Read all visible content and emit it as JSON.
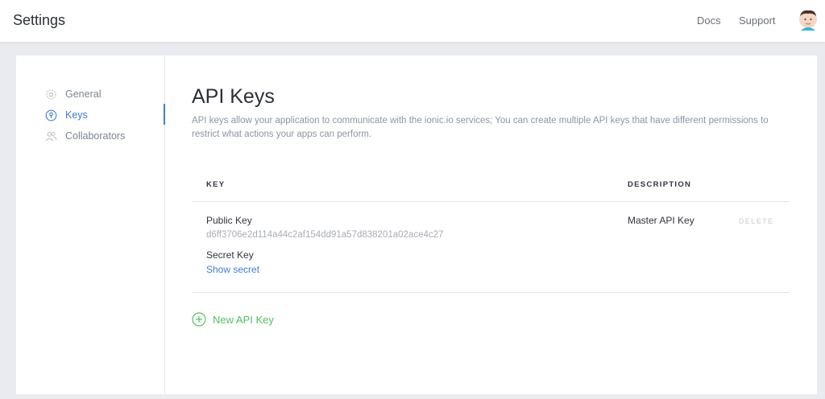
{
  "header": {
    "title": "Settings",
    "links": {
      "docs": "Docs",
      "support": "Support"
    }
  },
  "sidebar": {
    "items": [
      {
        "label": "General",
        "icon": "gear-icon",
        "active": false
      },
      {
        "label": "Keys",
        "icon": "key-icon",
        "active": true
      },
      {
        "label": "Collaborators",
        "icon": "users-icon",
        "active": false
      }
    ]
  },
  "main": {
    "title": "API Keys",
    "description": "API keys allow your application to communicate with the ionic.io services; You can create multiple API keys that have different permissions to restrict what actions your apps can perform.",
    "table": {
      "columns": {
        "key": "KEY",
        "description": "DESCRIPTION"
      },
      "rows": [
        {
          "public_label": "Public Key",
          "public_value": "d6ff3706e2d114a44c2af154dd91a57d838201a02ace4c27",
          "secret_label": "Secret Key",
          "secret_action": "Show secret",
          "description": "Master API Key",
          "delete_label": "DELETE"
        }
      ]
    },
    "new_key_label": "New API Key"
  },
  "colors": {
    "accent": "#3d7ed8",
    "success": "#4cc45e",
    "background": "#e9ebf1"
  }
}
